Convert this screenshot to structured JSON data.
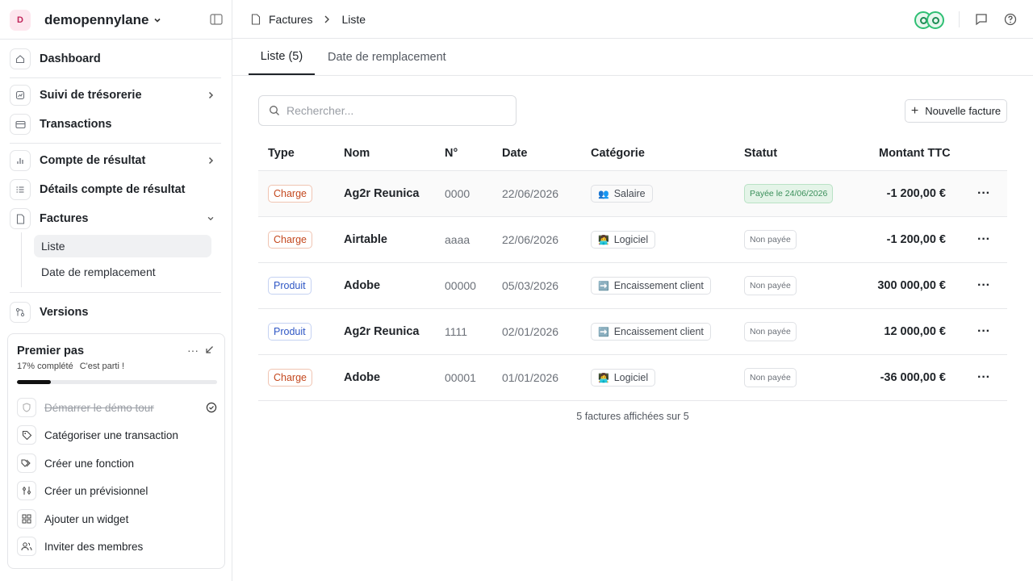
{
  "workspace": {
    "avatar_letter": "D",
    "name": "demopennylane"
  },
  "sidebar": {
    "items": [
      {
        "label": "Dashboard"
      },
      {
        "label": "Suivi de trésorerie"
      },
      {
        "label": "Transactions"
      },
      {
        "label": "Compte de résultat"
      },
      {
        "label": "Détails compte de résultat"
      },
      {
        "label": "Factures"
      },
      {
        "label": "Versions"
      }
    ],
    "sub_items": [
      {
        "label": "Liste"
      },
      {
        "label": "Date de remplacement"
      }
    ]
  },
  "onboarding": {
    "title": "Premier pas",
    "progress_text": "17% complété",
    "cta_text": "C'est parti !",
    "progress": 0.17,
    "steps": [
      {
        "label": "Démarrer le démo tour",
        "done": true
      },
      {
        "label": "Catégoriser une transaction",
        "done": false
      },
      {
        "label": "Créer une fonction",
        "done": false
      },
      {
        "label": "Créer un prévisionnel",
        "done": false
      },
      {
        "label": "Ajouter un widget",
        "done": false
      },
      {
        "label": "Inviter des membres",
        "done": false
      }
    ]
  },
  "breadcrumb": {
    "root": "Factures",
    "current": "Liste"
  },
  "tabs": [
    {
      "label": "Liste (5)",
      "active": true
    },
    {
      "label": "Date de remplacement",
      "active": false
    }
  ],
  "search": {
    "placeholder": "Rechercher...",
    "value": ""
  },
  "new_invoice_label": "Nouvelle facture",
  "table": {
    "headers": {
      "type": "Type",
      "nom": "Nom",
      "numero": "N°",
      "date": "Date",
      "categorie": "Catégorie",
      "statut": "Statut",
      "montant": "Montant TTC"
    },
    "rows": [
      {
        "type": "Charge",
        "nom": "Ag2r Reunica",
        "numero": "0000",
        "date": "22/06/2026",
        "categorie": "Salaire",
        "cat_emoji": "👥",
        "statut": "Payée le 24/06/2026",
        "montant": "-1 200,00 €"
      },
      {
        "type": "Charge",
        "nom": "Airtable",
        "numero": "aaaa",
        "date": "22/06/2026",
        "categorie": "Logiciel",
        "cat_emoji": "👩‍💻",
        "statut": "Non payée",
        "montant": "-1 200,00 €"
      },
      {
        "type": "Produit",
        "nom": "Adobe",
        "numero": "00000",
        "date": "05/03/2026",
        "categorie": "Encaissement client",
        "cat_emoji": "➡️",
        "statut": "Non payée",
        "montant": "300 000,00 €"
      },
      {
        "type": "Produit",
        "nom": "Ag2r Reunica",
        "numero": "1111",
        "date": "02/01/2026",
        "categorie": "Encaissement client",
        "cat_emoji": "➡️",
        "statut": "Non payée",
        "montant": "12 000,00 €"
      },
      {
        "type": "Charge",
        "nom": "Adobe",
        "numero": "00001",
        "date": "01/01/2026",
        "categorie": "Logiciel",
        "cat_emoji": "👩‍💻",
        "statut": "Non payée",
        "montant": "-36 000,00 €"
      }
    ],
    "more_label": "···",
    "footer": "5 factures affichées sur 5"
  },
  "colors": {
    "charge": "#c4481e",
    "produit": "#2f57c5",
    "paid_bg": "#e4f4e8",
    "paid_text": "#3a8f5a"
  }
}
